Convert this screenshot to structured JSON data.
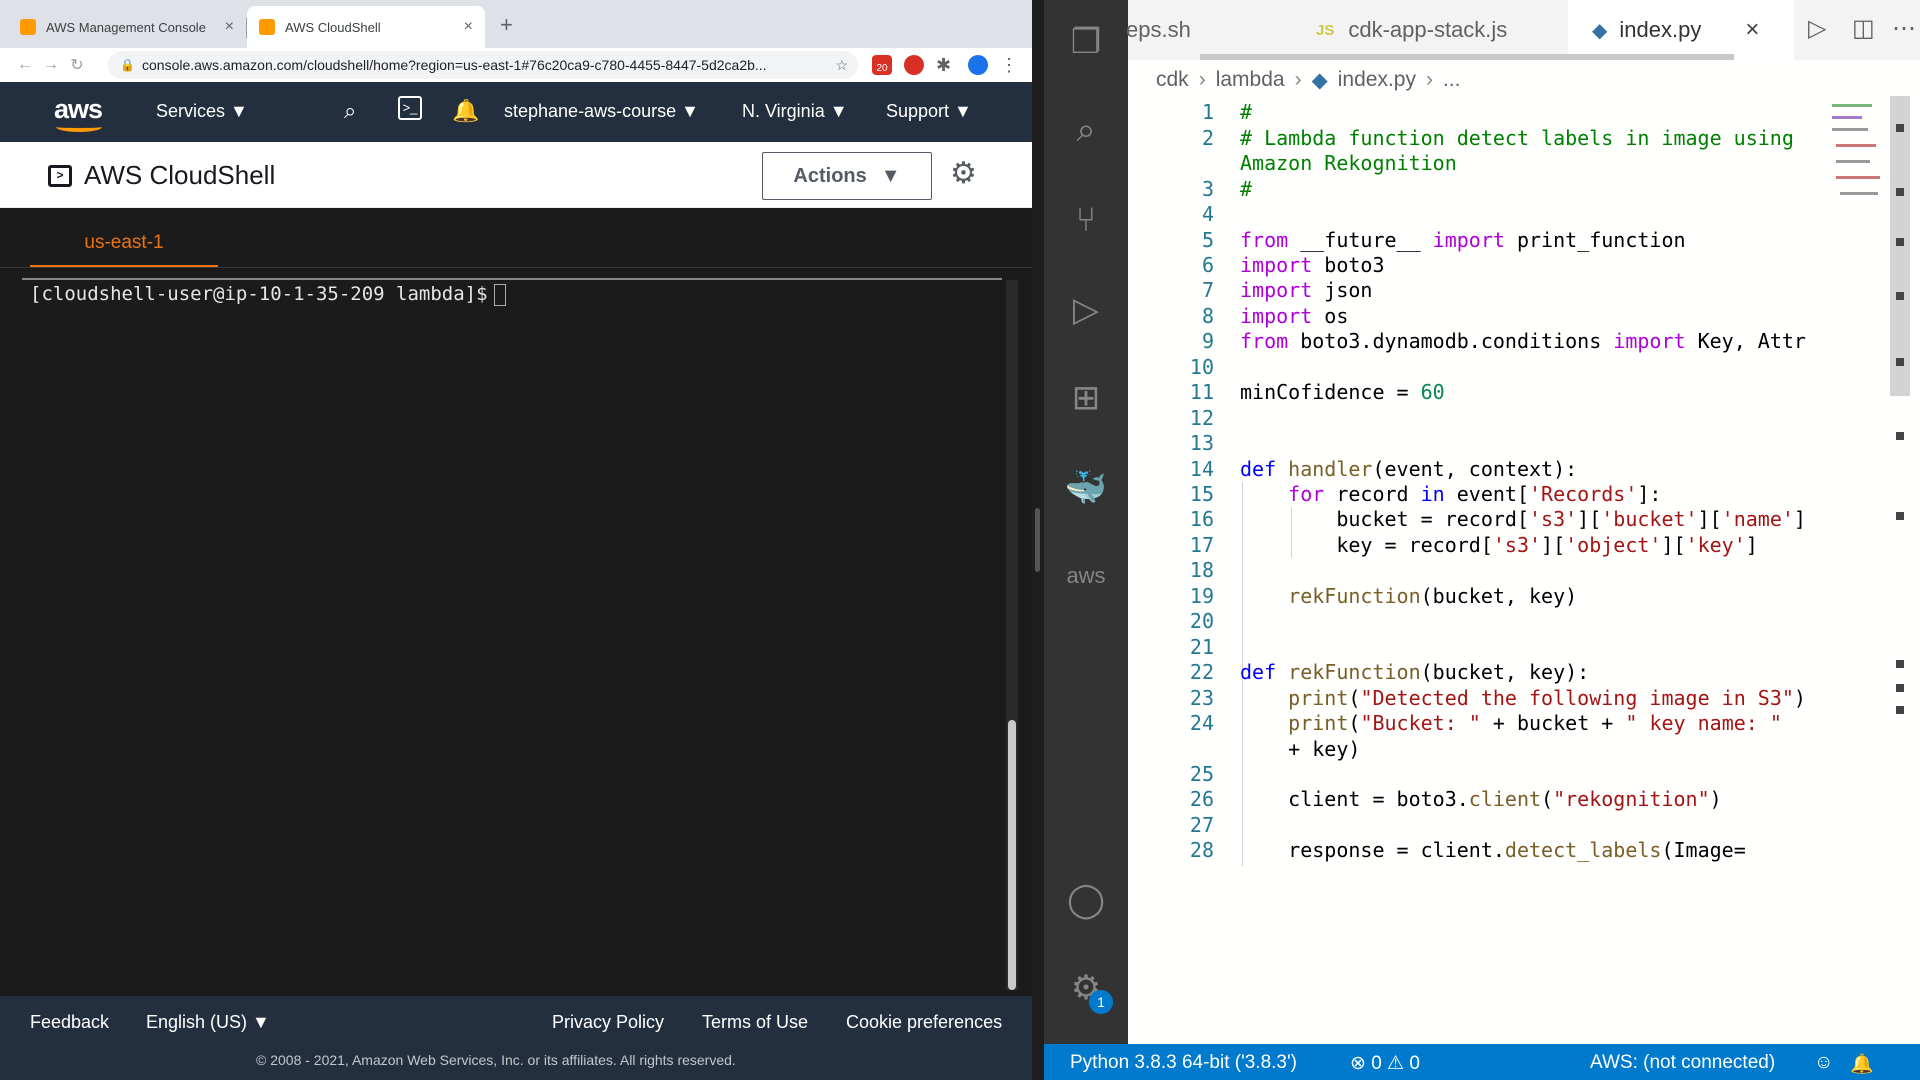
{
  "browser": {
    "tabs": [
      {
        "title": "AWS Management Console"
      },
      {
        "title": "AWS CloudShell"
      }
    ],
    "url": "console.aws.amazon.com/cloudshell/home?region=us-east-1#76c20ca9-c780-4455-8447-5d2ca2b...",
    "extension_badge": "20"
  },
  "aws_nav": {
    "logo": "aws",
    "services": "Services ▼",
    "account": "stephane-aws-course ▼",
    "region": "N. Virginia ▼",
    "support": "Support ▼"
  },
  "cloudshell": {
    "title": "AWS CloudShell",
    "actions_label": "Actions",
    "terminal_tab": "us-east-1",
    "prompt": "[cloudshell-user@ip-10-1-35-209 lambda]$"
  },
  "footer": {
    "feedback": "Feedback",
    "language": "English (US) ▼",
    "privacy": "Privacy Policy",
    "terms": "Terms of Use",
    "cookies": "Cookie preferences",
    "copyright": "© 2008 - 2021, Amazon Web Services, Inc. or its affiliates. All rights reserved."
  },
  "vscode": {
    "tabs": [
      {
        "label": "eps.sh"
      },
      {
        "label": "cdk-app-stack.js"
      },
      {
        "label": "index.py"
      }
    ],
    "breadcrumb": [
      "cdk",
      "lambda",
      "index.py",
      "..."
    ],
    "activity_badge": "1",
    "status": {
      "python": "Python 3.8.3 64-bit ('3.8.3')",
      "problems": "⊗ 0 ⚠ 0",
      "aws": "AWS: (not connected)"
    }
  },
  "code_lines": [
    "1",
    "2",
    "3",
    "4",
    "5",
    "6",
    "7",
    "8",
    "9",
    "10",
    "11",
    "12",
    "13",
    "14",
    "15",
    "16",
    "17",
    "18",
    "19",
    "20",
    "21",
    "22",
    "23",
    "24",
    "25",
    "26",
    "27",
    "28"
  ]
}
